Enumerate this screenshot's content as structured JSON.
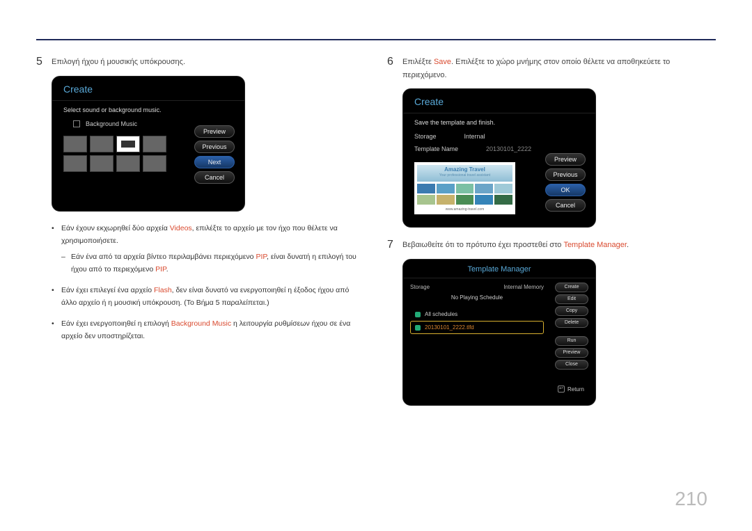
{
  "page_number": "210",
  "step5": {
    "num": "5",
    "text": "Επιλογή ήχου ή μουσικής υπόκρουσης."
  },
  "card1": {
    "title": "Create",
    "subtitle": "Select sound or background music.",
    "checkbox_label": "Background Music",
    "buttons": {
      "preview": "Preview",
      "previous": "Previous",
      "next": "Next",
      "cancel": "Cancel"
    }
  },
  "bullet1": {
    "pre": "Εάν έχουν εκχωρηθεί δύο αρχεία ",
    "hl": "Videos",
    "post": ", επιλέξτε το αρχείο με τον ήχο που θέλετε να χρησιμοποιήσετε."
  },
  "bullet1_sub": {
    "pre": "Εάν ένα από τα αρχεία βίντεο περιλαμβάνει περιεχόμενο ",
    "hl1": "PIP",
    "mid": ", είναι δυνατή η επιλογή του ήχου από το περιεχόμενο ",
    "hl2": "PIP",
    "post": "."
  },
  "bullet2": {
    "pre": "Εάν έχει επιλεγεί ένα αρχείο ",
    "hl": "Flash",
    "post": ", δεν είναι δυνατό να ενεργοποιηθεί η έξοδος ήχου από άλλο αρχείο ή η μουσική υπόκρουση. (Το Βήμα 5 παραλείπεται.)"
  },
  "bullet3": {
    "pre": "Εάν έχει ενεργοποιηθεί η επιλογή ",
    "hl": "Background Music",
    "post": " η λειτουργία ρυθμίσεων ήχου σε ένα αρχείο δεν υποστηρίζεται."
  },
  "step6": {
    "num": "6",
    "pre": "Επιλέξτε ",
    "hl": "Save",
    "post": ". Επιλέξτε το χώρο μνήμης στον οποίο θέλετε να αποθηκεύετε το περιεχόμενο."
  },
  "card2": {
    "title": "Create",
    "subtitle": "Save the template and finish.",
    "storage_label": "Storage",
    "storage_value": "Internal",
    "name_label": "Template Name",
    "name_value": "20130101_2222",
    "banner_title": "Amazing Travel",
    "banner_sub": "Your professional travel assistant",
    "url": "www.amazing-travel.com",
    "buttons": {
      "preview": "Preview",
      "previous": "Previous",
      "ok": "OK",
      "cancel": "Cancel"
    }
  },
  "step7": {
    "num": "7",
    "pre": "Βεβαιωθείτε ότι το πρότυπο έχει προστεθεί στο ",
    "hl": "Template Manager",
    "post": "."
  },
  "card3": {
    "title": "Template Manager",
    "storage_label": "Storage",
    "storage_value": "Internal Memory",
    "schedule_msg": "No Playing Schedule",
    "row1": "All schedules",
    "row2": "20130101_2222.tlfd",
    "buttons": {
      "create": "Create",
      "edit": "Edit",
      "copy": "Copy",
      "delete": "Delete",
      "run": "Run",
      "preview": "Preview",
      "close": "Close"
    },
    "return": "Return"
  }
}
